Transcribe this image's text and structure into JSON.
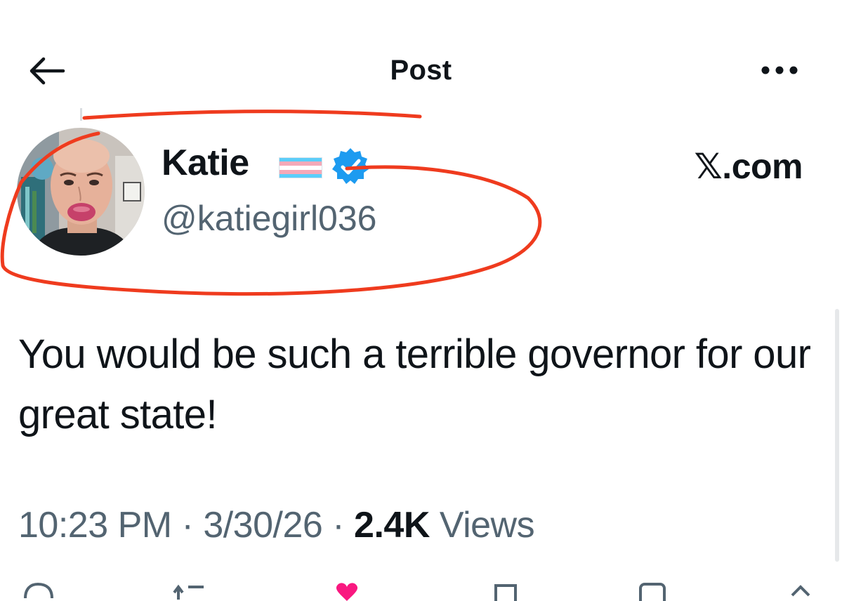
{
  "header": {
    "title": "Post",
    "back_icon": "arrow-left-icon",
    "more_icon": "more-horizontal-icon"
  },
  "author": {
    "display_name": "Katie",
    "flag_icon": "transgender-flag-icon",
    "verified_icon": "verified-badge-icon",
    "handle": "@katiegirl036"
  },
  "site_label": "𝕏.com",
  "post": {
    "text": "You would be such a terrible governor for our great state!",
    "time": "10:23 PM",
    "separator": "·",
    "date": "3/30/26",
    "views_count": "2.4K",
    "views_label": "Views"
  },
  "actions": [
    "reply-icon",
    "repost-icon",
    "like-icon",
    "bookmark-icon",
    "share-icon",
    "upload-icon"
  ],
  "colors": {
    "text_primary": "#0f1419",
    "text_secondary": "#536471",
    "verified_blue": "#1d9bf0",
    "annotation_red": "#ef3b1e",
    "like_pink": "#f91880",
    "flag_blue": "#5bcefa",
    "flag_pink": "#f5a9b8"
  }
}
